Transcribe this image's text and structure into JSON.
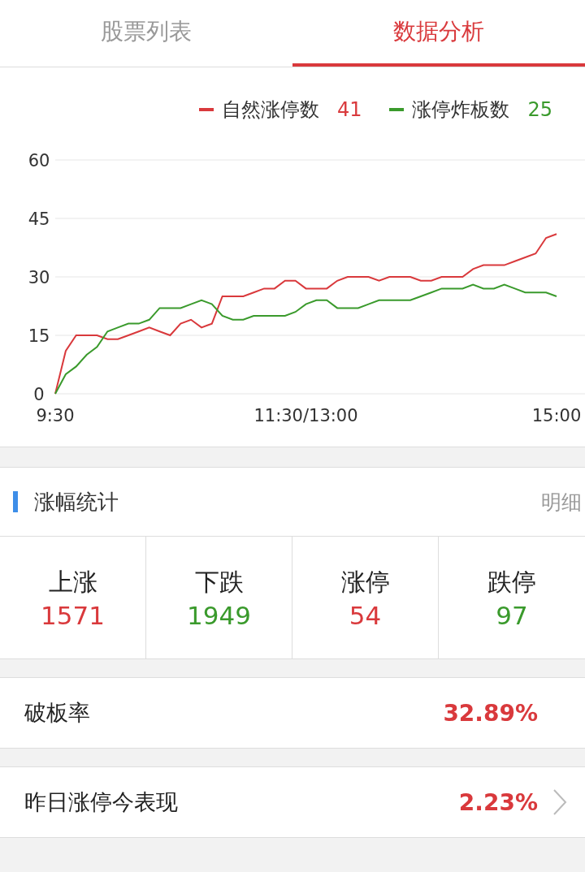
{
  "tabs": [
    {
      "label": "股票列表",
      "selected": false
    },
    {
      "label": "数据分析",
      "selected": true
    }
  ],
  "chart": {
    "legend_values": [
      "41",
      "25"
    ],
    "chart_data": {
      "type": "line",
      "grid": true,
      "x": [
        "9:30",
        null,
        null,
        null,
        null,
        null,
        null,
        null,
        null,
        null,
        null,
        null,
        null,
        null,
        null,
        null,
        null,
        null,
        null,
        null,
        null,
        null,
        null,
        null,
        "11:30/13:00",
        null,
        null,
        null,
        null,
        null,
        null,
        null,
        null,
        null,
        null,
        null,
        null,
        null,
        null,
        null,
        null,
        null,
        null,
        null,
        null,
        null,
        null,
        null,
        "15:00"
      ],
      "series": [
        {
          "name": "自然涨停数",
          "color": "#d9393c",
          "values": [
            0,
            11,
            15,
            15,
            15,
            14,
            14,
            15,
            16,
            17,
            16,
            15,
            18,
            19,
            17,
            18,
            25,
            25,
            25,
            26,
            27,
            27,
            29,
            29,
            27,
            27,
            27,
            29,
            30,
            30,
            30,
            29,
            30,
            30,
            30,
            29,
            29,
            30,
            30,
            30,
            32,
            33,
            33,
            33,
            34,
            35,
            36,
            40,
            41
          ]
        },
        {
          "name": "涨停炸板数",
          "color": "#3a9a2c",
          "values": [
            0,
            5,
            7,
            10,
            12,
            16,
            17,
            18,
            18,
            19,
            22,
            22,
            22,
            23,
            24,
            23,
            20,
            19,
            19,
            20,
            20,
            20,
            20,
            21,
            23,
            24,
            24,
            22,
            22,
            22,
            23,
            24,
            24,
            24,
            24,
            25,
            26,
            27,
            27,
            27,
            28,
            27,
            27,
            28,
            27,
            26,
            26,
            26,
            25
          ]
        }
      ],
      "ylim": [
        0,
        60
      ],
      "yticks": [
        0,
        15,
        30,
        45,
        60
      ]
    }
  },
  "section": {
    "title": "涨幅统计",
    "link": "明细"
  },
  "stats": [
    {
      "label": "上涨",
      "value": "1571",
      "color": "#d9393c"
    },
    {
      "label": "下跌",
      "value": "1949",
      "color": "#3a9a2c"
    },
    {
      "label": "涨停",
      "value": "54",
      "color": "#d9393c"
    },
    {
      "label": "跌停",
      "value": "97",
      "color": "#3a9a2c"
    }
  ],
  "rows": [
    {
      "label": "破板率",
      "value": "32.89%",
      "chevron": false
    },
    {
      "label": "昨日涨停今表现",
      "value": "2.23%",
      "chevron": true
    }
  ]
}
